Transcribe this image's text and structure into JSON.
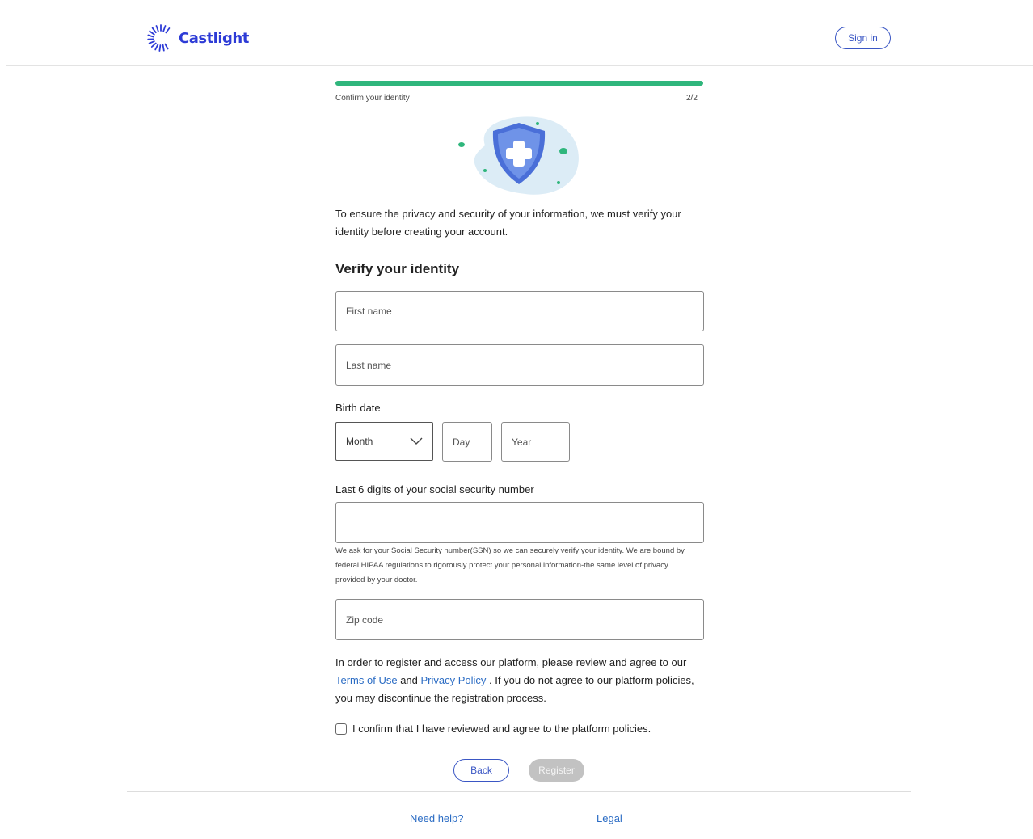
{
  "header": {
    "logo_text": "Castlight",
    "signin_label": "Sign in"
  },
  "progress": {
    "step_label": "Confirm your identity",
    "step_count": "2/2",
    "fraction": 1.0,
    "color": "#2fb67c"
  },
  "hero": {
    "icon": "shield-plus-icon"
  },
  "intro": "To ensure the privacy and security of your information, we must verify your identity before creating your account.",
  "form": {
    "title": "Verify your identity",
    "first_name": {
      "placeholder": "First name",
      "value": ""
    },
    "last_name": {
      "placeholder": "Last name",
      "value": ""
    },
    "birth_date": {
      "label": "Birth date",
      "month": "Month",
      "day_placeholder": "Day",
      "year_placeholder": "Year"
    },
    "ssn": {
      "label": "Last 6 digits of your social security number",
      "value": "",
      "hint": "We ask for your Social Security number(SSN) so we can securely verify your identity. We are bound by federal HIPAA regulations to rigorously protect your personal information-the same level of privacy provided by your doctor."
    },
    "zip": {
      "placeholder": "Zip code",
      "value": ""
    }
  },
  "consent": {
    "text_before": "In order to register and access our platform, please review and agree to our ",
    "terms_link": "Terms of Use",
    "and": " and ",
    "privacy_link": "Privacy Policy",
    "text_after": " . If you do not agree to our platform policies, you may discontinue the registration process.",
    "checkbox_label": "I confirm that I have reviewed and agree to the platform policies.",
    "checked": false
  },
  "actions": {
    "back_label": "Back",
    "register_label": "Register"
  },
  "footer": {
    "help_label": "Need help?",
    "legal_label": "Legal"
  },
  "colors": {
    "brand": "#2d3bd6",
    "link": "#2b6cc4",
    "progress": "#2fb67c",
    "disabled": "#c2c2c2"
  }
}
